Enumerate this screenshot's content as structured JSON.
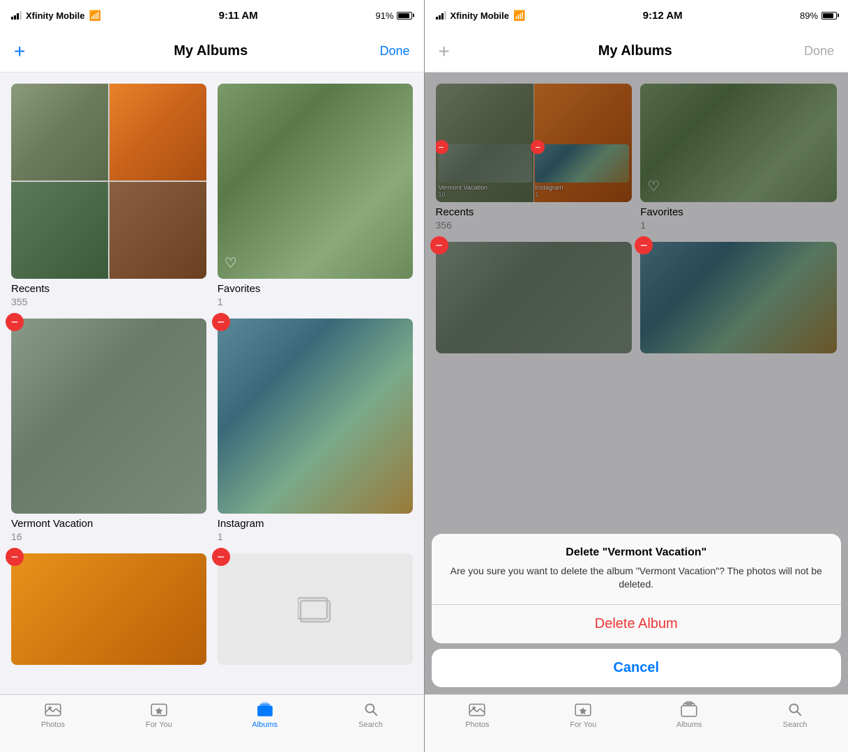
{
  "left": {
    "status": {
      "carrier": "Xfinity Mobile",
      "time": "9:11 AM",
      "battery": "91%",
      "battery_pct": 91
    },
    "nav": {
      "add_label": "+",
      "title": "My Albums",
      "done_label": "Done",
      "done_active": true
    },
    "albums": [
      {
        "id": "recents",
        "name": "Recents",
        "count": "355",
        "type": "collage",
        "has_delete": false,
        "has_heart": false
      },
      {
        "id": "favorites",
        "name": "Favorites",
        "count": "1",
        "type": "single-forest",
        "has_delete": false,
        "has_heart": true
      },
      {
        "id": "vermont",
        "name": "Vermont Vacation",
        "count": "16",
        "type": "single-vermont",
        "has_delete": true,
        "has_heart": false
      },
      {
        "id": "instagram",
        "name": "Instagram",
        "count": "1",
        "type": "single-instagram",
        "has_delete": true,
        "has_heart": false
      },
      {
        "id": "album5",
        "name": "",
        "count": "",
        "type": "single-orange",
        "has_delete": true,
        "has_heart": false
      },
      {
        "id": "album6",
        "name": "",
        "count": "",
        "type": "empty",
        "has_delete": true,
        "has_heart": false
      }
    ],
    "tabs": [
      {
        "id": "photos",
        "label": "Photos",
        "active": false
      },
      {
        "id": "foryou",
        "label": "For You",
        "active": false
      },
      {
        "id": "albums",
        "label": "Albums",
        "active": true
      },
      {
        "id": "search",
        "label": "Search",
        "active": false
      }
    ]
  },
  "right": {
    "status": {
      "carrier": "Xfinity Mobile",
      "time": "9:12 AM",
      "battery": "89%",
      "battery_pct": 89
    },
    "nav": {
      "add_label": "+",
      "title": "My Albums",
      "done_label": "Done",
      "done_active": false
    },
    "mini_albums": [
      {
        "id": "recents",
        "name": "Recents",
        "count": "356",
        "type": "collage-mini"
      },
      {
        "id": "favorites",
        "name": "Favorites",
        "count": "",
        "type": "single-forest-mini"
      }
    ],
    "albums_with_delete": [
      {
        "id": "vermont",
        "name": "Vermont Vacation",
        "count": "16",
        "type": "single-vermont"
      },
      {
        "id": "instagram",
        "name": "Instagram",
        "count": "1",
        "type": "single-instagram"
      }
    ],
    "full_albums": [
      {
        "id": "recents",
        "name": "Recents",
        "count": "356",
        "type": "collage",
        "has_delete": false,
        "has_heart": false
      },
      {
        "id": "favorites",
        "name": "Favorites",
        "count": "1",
        "type": "single-forest",
        "has_delete": false,
        "has_heart": true
      },
      {
        "id": "vermont",
        "name": "Vermont Vacation",
        "count": "16",
        "type": "single-vermont",
        "has_delete": true,
        "has_heart": false
      },
      {
        "id": "instagram",
        "name": "Instagram",
        "count": "1",
        "type": "single-instagram",
        "has_delete": true,
        "has_heart": false
      },
      {
        "id": "album5",
        "name": "",
        "count": "",
        "type": "single-orange",
        "has_delete": true,
        "has_heart": false
      }
    ],
    "alert": {
      "title": "Delete \"Vermont Vacation\"",
      "message": "Are you sure you want to delete the album \"Vermont Vacation\"? The photos will not be deleted.",
      "delete_label": "Delete Album",
      "cancel_label": "Cancel"
    },
    "tabs": [
      {
        "id": "photos",
        "label": "Photos",
        "active": false
      },
      {
        "id": "foryou",
        "label": "For You",
        "active": false
      },
      {
        "id": "albums",
        "label": "Albums",
        "active": false
      },
      {
        "id": "search",
        "label": "Search",
        "active": false
      }
    ]
  }
}
